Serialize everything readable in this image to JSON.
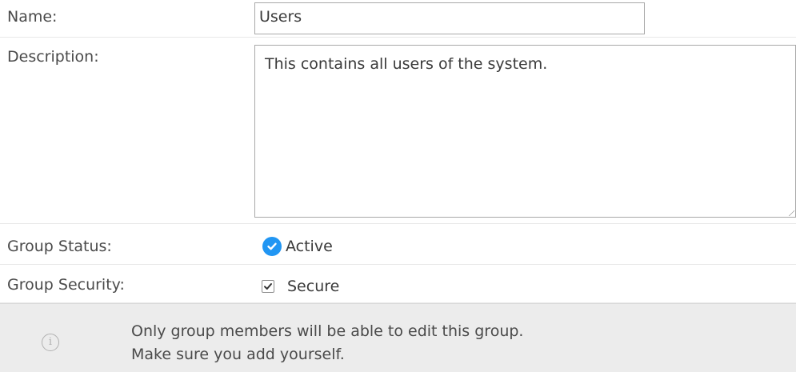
{
  "form": {
    "name": {
      "label": "Name:",
      "value": "Users"
    },
    "description": {
      "label": "Description:",
      "value": "This contains all users of the system."
    },
    "status": {
      "label": "Group Status:",
      "value": "Active",
      "icon": "check-circle-icon",
      "color": "#2196f3"
    },
    "security": {
      "label": "Group Security:",
      "checkbox_label": "Secure",
      "checked": true
    }
  },
  "notice": {
    "icon": "info-icon",
    "line1": "Only group members will be able to edit this group.",
    "line2": "Make sure you add yourself."
  }
}
